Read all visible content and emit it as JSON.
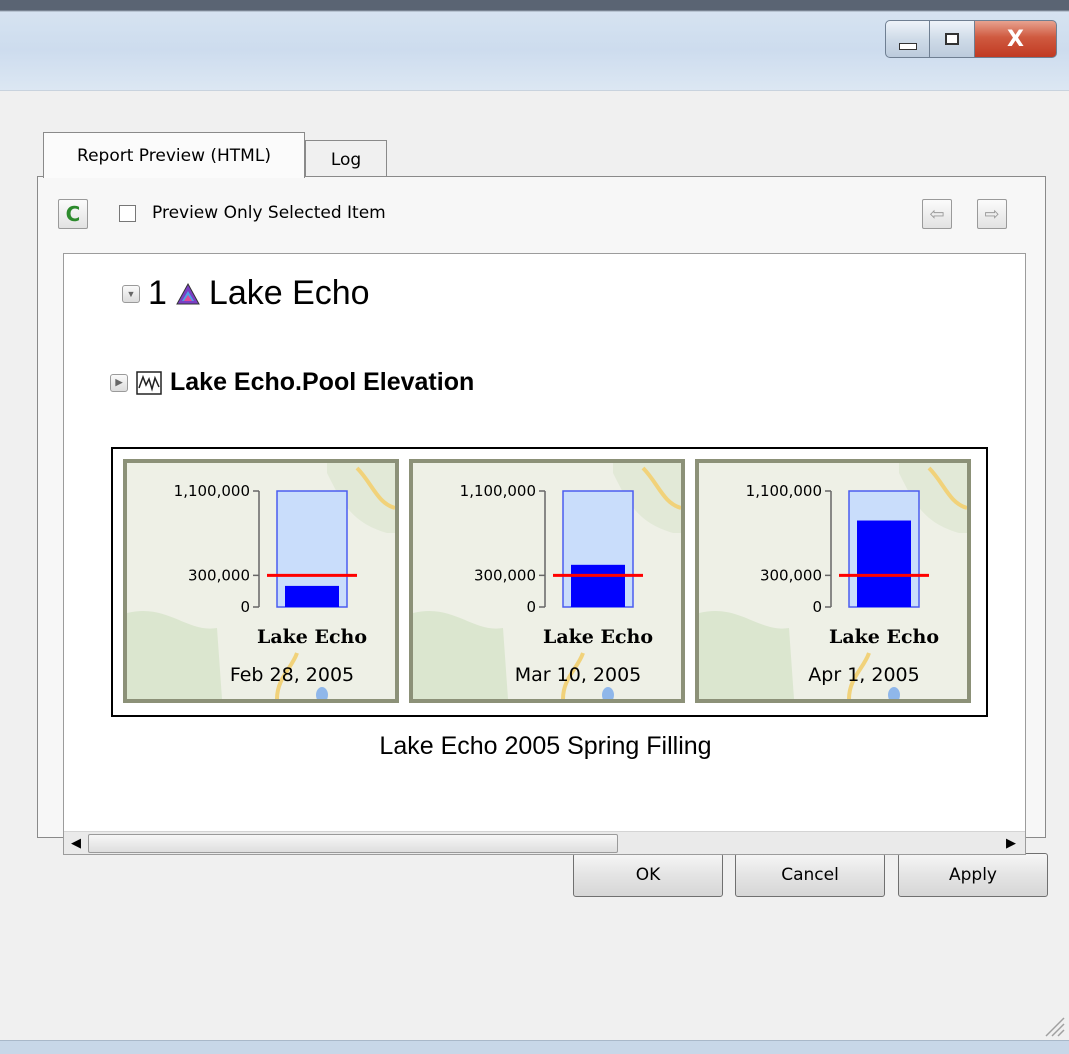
{
  "window": {
    "minimize_icon": "minimize-icon",
    "maximize_icon": "maximize-icon",
    "close_glyph": "X"
  },
  "tabs": [
    {
      "label": "Report Preview (HTML)",
      "active": true
    },
    {
      "label": "Log",
      "active": false
    }
  ],
  "toolbar": {
    "refresh_glyph": "C",
    "checkbox_label": "Preview Only Selected Item",
    "checkbox_checked": false,
    "back_glyph": "⇦",
    "forward_glyph": "⇨"
  },
  "report": {
    "item_number": "1",
    "item_title": "Lake Echo",
    "slot_title": "Lake Echo.Pool Elevation",
    "caption": "Lake Echo 2005 Spring Filling"
  },
  "chart_data": [
    {
      "type": "bar",
      "title": "Lake Echo",
      "date": "Feb 28, 2005",
      "yticks": [
        "1,100,000",
        "300,000",
        "0"
      ],
      "ylim": [
        0,
        1100000
      ],
      "value": 200000,
      "reference_line": 300000,
      "colors": {
        "fill": "#0000ff",
        "capacity": "#c9ddfb",
        "reference": "#ff0000"
      }
    },
    {
      "type": "bar",
      "title": "Lake Echo",
      "date": "Mar 10, 2005",
      "yticks": [
        "1,100,000",
        "300,000",
        "0"
      ],
      "ylim": [
        0,
        1100000
      ],
      "value": 400000,
      "reference_line": 300000,
      "colors": {
        "fill": "#0000ff",
        "capacity": "#c9ddfb",
        "reference": "#ff0000"
      }
    },
    {
      "type": "bar",
      "title": "Lake Echo",
      "date": "Apr 1, 2005",
      "yticks": [
        "1,100,000",
        "300,000",
        "0"
      ],
      "ylim": [
        0,
        1100000
      ],
      "value": 820000,
      "reference_line": 300000,
      "colors": {
        "fill": "#0000ff",
        "capacity": "#c9ddfb",
        "reference": "#ff0000"
      }
    }
  ],
  "scrollbar": {
    "left_glyph": "◀",
    "right_glyph": "▶"
  },
  "buttons": {
    "ok": "OK",
    "cancel": "Cancel",
    "apply": "Apply"
  }
}
